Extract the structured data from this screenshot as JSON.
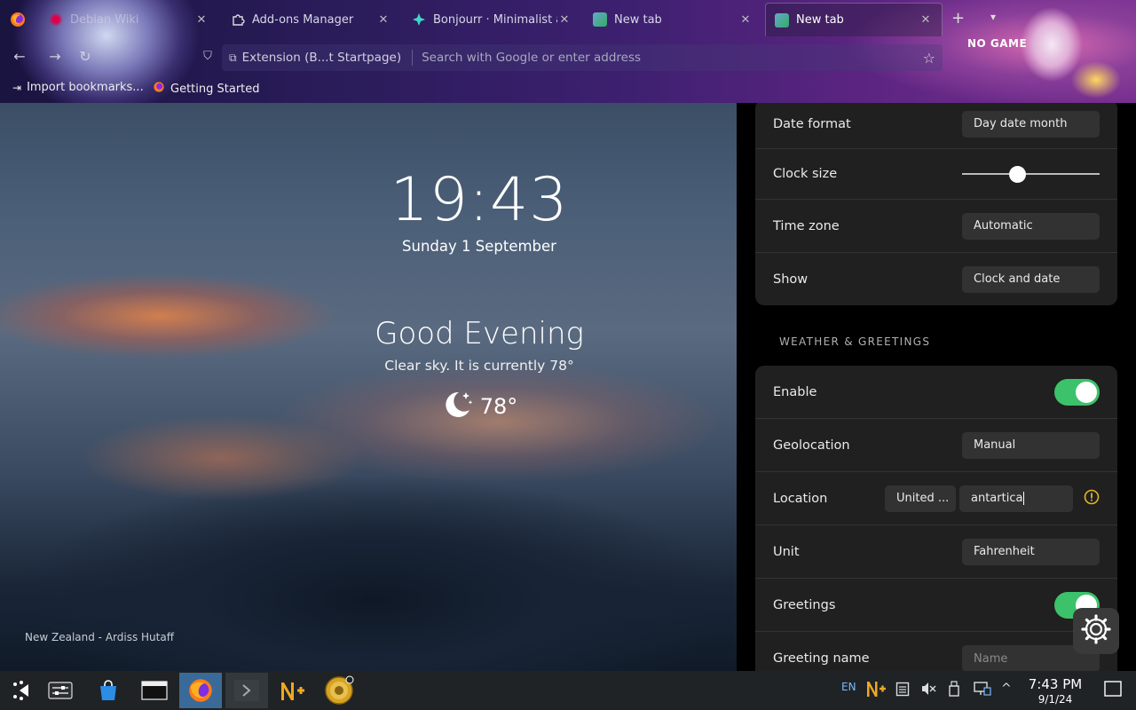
{
  "browser": {
    "tabs": [
      {
        "title": "Debian Wiki",
        "favicon": "debian-icon",
        "active": false
      },
      {
        "title": "Add-ons Manager",
        "favicon": "puzzle-icon",
        "active": false
      },
      {
        "title": "Bonjourr · Minimalist a",
        "favicon": "bonjourr-icon",
        "active": false
      },
      {
        "title": "New tab",
        "favicon": "bonjourr-icon",
        "active": false
      },
      {
        "title": "New tab",
        "favicon": "bonjourr-icon",
        "active": true
      }
    ],
    "new_tab_symbol": "+",
    "address_chip": "Extension (B...t Startpage)",
    "address_placeholder": "Search with Google or enter address",
    "bookmarks": [
      {
        "label": "Import bookmarks...",
        "icon": "import-icon"
      },
      {
        "label": "Getting Started",
        "icon": "firefox-icon"
      }
    ],
    "theme_text": "NO GAME"
  },
  "newtab": {
    "clock": "19:43",
    "date": "Sunday 1 September",
    "greeting": "Good Evening",
    "weather_description": "Clear sky. It is currently 78°",
    "weather_icon": "moon-stars-icon",
    "temperature": "78°",
    "photo_credit": "New Zealand - Ardiss Hutaff"
  },
  "settings": {
    "time_rows": [
      {
        "label": "Date format",
        "value": "Day date month"
      },
      {
        "label": "Clock size",
        "slider_fraction": 0.4
      },
      {
        "label": "Time zone",
        "value": "Automatic"
      },
      {
        "label": "Show",
        "value": "Clock and date"
      }
    ],
    "weather_section_title": "WEATHER & GREETINGS",
    "weather_rows": {
      "enable": {
        "label": "Enable",
        "on": true
      },
      "geolocation": {
        "label": "Geolocation",
        "value": "Manual"
      },
      "location": {
        "label": "Location",
        "country": "United ...",
        "city": "antartica",
        "warning_icon": "warning-icon"
      },
      "unit": {
        "label": "Unit",
        "value": "Fahrenheit"
      },
      "greetings": {
        "label": "Greetings",
        "on": true
      },
      "greeting_name": {
        "label": "Greeting name",
        "placeholder": "Name"
      }
    },
    "settings_button_icon": "gear-icon"
  },
  "taskbar": {
    "apps": [
      {
        "name": "app-launcher-icon"
      },
      {
        "name": "system-settings-icon"
      },
      {
        "name": "discover-store-icon"
      },
      {
        "name": "terminal-window-icon"
      },
      {
        "name": "firefox-icon",
        "active": true
      },
      {
        "name": "konsole-icon"
      },
      {
        "name": "notepad-plus-icon"
      },
      {
        "name": "gold-coin-icon"
      }
    ],
    "tray": {
      "language": "EN",
      "time": "7:43 PM",
      "date": "9/1/24"
    }
  },
  "colors": {
    "toggle_on": "#3cc26a",
    "panel_card": "#202020",
    "warning": "#e6b422",
    "taskbar_active": "#3a6a98"
  }
}
